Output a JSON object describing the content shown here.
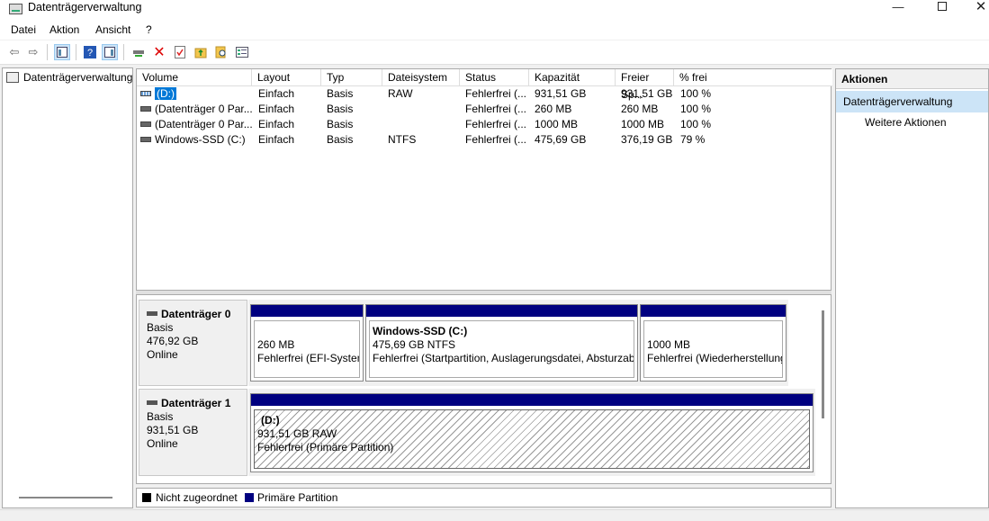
{
  "window": {
    "title": "Datenträgerverwaltung"
  },
  "menu": [
    "Datei",
    "Aktion",
    "Ansicht",
    "?"
  ],
  "tree": {
    "root": "Datenträgerverwaltung"
  },
  "columns": [
    "Volume",
    "Layout",
    "Typ",
    "Dateisystem",
    "Status",
    "Kapazität",
    "Freier Sp...",
    "% frei"
  ],
  "volumes": [
    {
      "volume": "(D:)",
      "layout": "Einfach",
      "typ": "Basis",
      "fs": "RAW",
      "status": "Fehlerfrei (...",
      "cap": "931,51 GB",
      "free": "931,51 GB",
      "pct": "100 %"
    },
    {
      "volume": "(Datenträger 0 Par...",
      "layout": "Einfach",
      "typ": "Basis",
      "fs": "",
      "status": "Fehlerfrei (...",
      "cap": "260 MB",
      "free": "260 MB",
      "pct": "100 %"
    },
    {
      "volume": "(Datenträger 0 Par...",
      "layout": "Einfach",
      "typ": "Basis",
      "fs": "",
      "status": "Fehlerfrei (...",
      "cap": "1000 MB",
      "free": "1000 MB",
      "pct": "100 %"
    },
    {
      "volume": "Windows-SSD (C:)",
      "layout": "Einfach",
      "typ": "Basis",
      "fs": "NTFS",
      "status": "Fehlerfrei (...",
      "cap": "475,69 GB",
      "free": "376,19 GB",
      "pct": "79 %"
    }
  ],
  "disks": [
    {
      "name": "Datenträger 0",
      "type": "Basis",
      "size": "476,92 GB",
      "state": "Online",
      "parts": [
        {
          "title": "",
          "line1": "260 MB",
          "line2": "Fehlerfrei (EFI-System"
        },
        {
          "title": "Windows-SSD  (C:)",
          "line1": "475,69 GB NTFS",
          "line2": "Fehlerfrei (Startpartition, Auslagerungsdatei, Absturzab"
        },
        {
          "title": "",
          "line1": "1000 MB",
          "line2": "Fehlerfrei (Wiederherstellung"
        }
      ]
    },
    {
      "name": "Datenträger 1",
      "type": "Basis",
      "size": "931,51 GB",
      "state": "Online",
      "parts": [
        {
          "title": "(D:)",
          "line1": "931,51 GB RAW",
          "line2": "Fehlerfrei (Primäre Partition)"
        }
      ]
    }
  ],
  "legend": [
    {
      "label": "Nicht zugeordnet",
      "color": "#000000"
    },
    {
      "label": "Primäre Partition",
      "color": "#000080"
    }
  ],
  "actions": {
    "header": "Aktionen",
    "section": "Datenträgerverwaltung",
    "more": "Weitere Aktionen"
  }
}
